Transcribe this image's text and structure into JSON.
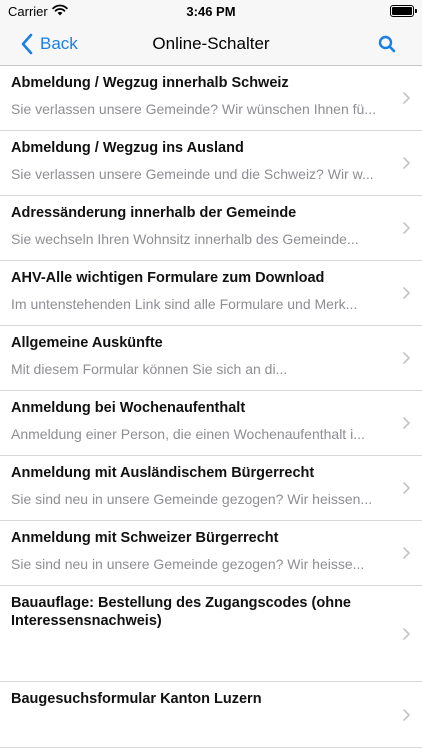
{
  "status_bar": {
    "carrier": "Carrier",
    "time": "3:46 PM",
    "wifi_icon": "wifi-icon",
    "battery_icon": "battery-icon"
  },
  "nav": {
    "back_label": "Back",
    "title": "Online-Schalter",
    "search_icon": "search-icon",
    "accent_color": "#1a7fe6"
  },
  "items": [
    {
      "title": "Abmeldung / Wegzug innerhalb Schweiz",
      "subtitle": "Sie verlassen unsere Gemeinde? Wir wünschen Ihnen fü..."
    },
    {
      "title": "Abmeldung / Wegzug ins Ausland",
      "subtitle": "Sie verlassen unsere Gemeinde und die Schweiz? Wir w..."
    },
    {
      "title": "Adressänderung innerhalb der Gemeinde",
      "subtitle": "Sie wechseln Ihren Wohnsitz innerhalb des Gemeinde..."
    },
    {
      "title": "AHV-Alle wichtigen Formulare zum Download",
      "subtitle": "Im untenstehenden Link sind alle Formulare und Merk..."
    },
    {
      "title": "Allgemeine Auskünfte",
      "subtitle": "Mit diesem Formular können Sie sich an di..."
    },
    {
      "title": "Anmeldung bei Wochenaufenthalt",
      "subtitle": "Anmeldung einer Person, die einen Wochenaufenthalt i..."
    },
    {
      "title": "Anmeldung mit Ausländischem Bürgerrecht",
      "subtitle": "Sie sind neu in unsere Gemeinde gezogen? Wir heissen..."
    },
    {
      "title": "Anmeldung mit Schweizer Bürgerrecht",
      "subtitle": "Sie sind neu in unsere Gemeinde gezogen? Wir heisse..."
    },
    {
      "title": "Bauauflage: Bestellung des Zugangscodes (ohne Interessensnachweis)",
      "subtitle": ""
    },
    {
      "title": "Baugesuchsformular Kanton Luzern",
      "subtitle": ""
    }
  ]
}
